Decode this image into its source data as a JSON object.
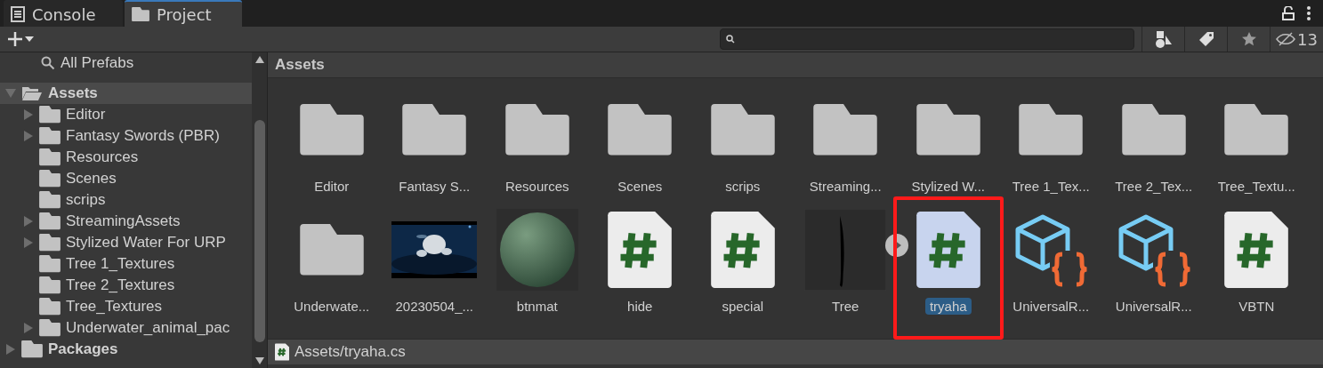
{
  "tabs": [
    {
      "label": "Console",
      "kind": "console",
      "selected": false
    },
    {
      "label": "Project",
      "kind": "folder",
      "selected": true
    }
  ],
  "toolbar": {
    "hidden_count": "13"
  },
  "sidebar": {
    "partial_item": "All Prefabs",
    "tree": [
      {
        "name": "Assets",
        "expanded": true,
        "selected": true,
        "children": [
          {
            "name": "Editor",
            "expanded": false,
            "selected": false
          },
          {
            "name": "Fantasy Swords (PBR)",
            "expanded": false,
            "selected": false
          },
          {
            "name": "Resources",
            "selected": false
          },
          {
            "name": "Scenes",
            "selected": false
          },
          {
            "name": "scrips",
            "selected": false
          },
          {
            "name": "StreamingAssets",
            "expanded": false,
            "selected": false
          },
          {
            "name": "Stylized Water For URP",
            "expanded": false,
            "selected": false
          },
          {
            "name": "Tree 1_Textures",
            "selected": false
          },
          {
            "name": "Tree 2_Textures",
            "selected": false
          },
          {
            "name": "Tree_Textures",
            "selected": false
          },
          {
            "name": "Underwater_animal_pac",
            "expanded": false,
            "selected": false
          }
        ]
      },
      {
        "name": "Packages",
        "expanded": false,
        "selected": false
      }
    ]
  },
  "breadcrumb": "Assets",
  "assets": [
    {
      "name": "Editor",
      "kind": "folder",
      "selected": false
    },
    {
      "name": "Fantasy S...",
      "kind": "folder",
      "selected": false
    },
    {
      "name": "Resources",
      "kind": "folder",
      "selected": false
    },
    {
      "name": "Scenes",
      "kind": "folder",
      "selected": false
    },
    {
      "name": "scrips",
      "kind": "folder",
      "selected": false
    },
    {
      "name": "Streaming...",
      "kind": "folder",
      "selected": false
    },
    {
      "name": "Stylized W...",
      "kind": "folder",
      "selected": false
    },
    {
      "name": "Tree 1_Tex...",
      "kind": "folder",
      "selected": false
    },
    {
      "name": "Tree 2_Tex...",
      "kind": "folder",
      "selected": false
    },
    {
      "name": "Tree_Textu...",
      "kind": "folder",
      "selected": false
    },
    {
      "name": "Underwate...",
      "kind": "folder",
      "selected": false
    },
    {
      "name": "20230504_...",
      "kind": "video",
      "selected": false
    },
    {
      "name": "btnmat",
      "kind": "material",
      "selected": false
    },
    {
      "name": "hide",
      "kind": "script",
      "selected": false
    },
    {
      "name": "special",
      "kind": "script",
      "selected": false
    },
    {
      "name": "Tree",
      "kind": "texture",
      "selected": false,
      "has_subassets": true
    },
    {
      "name": "tryaha",
      "kind": "script",
      "selected": true,
      "highlighted": true
    },
    {
      "name": "UniversalR...",
      "kind": "pipeline",
      "selected": false
    },
    {
      "name": "UniversalR...",
      "kind": "pipeline",
      "selected": false
    },
    {
      "name": "VBTN",
      "kind": "script",
      "selected": false
    }
  ],
  "status_bar": {
    "path": "Assets/tryaha.cs"
  }
}
